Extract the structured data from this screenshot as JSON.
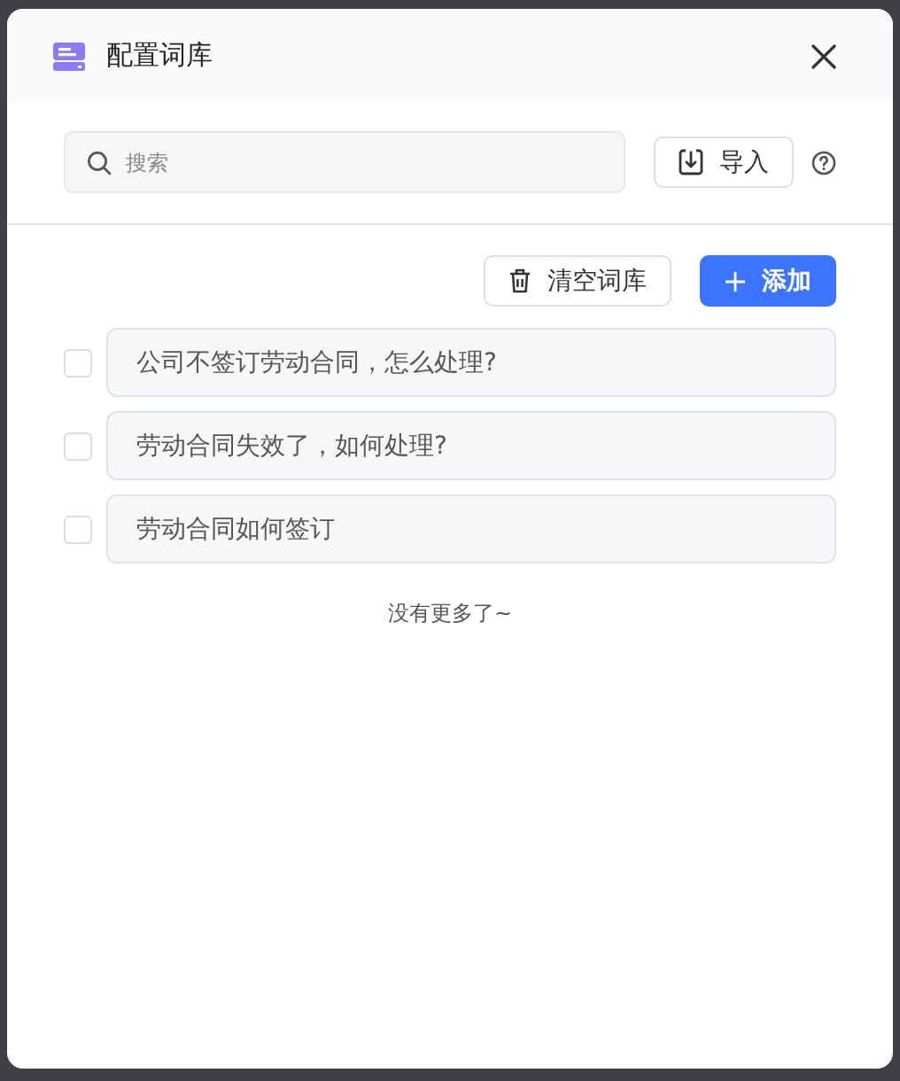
{
  "dialog": {
    "title": "配置词库"
  },
  "search": {
    "placeholder": "搜索"
  },
  "import_button": {
    "label": "导入"
  },
  "clear_button": {
    "label": "清空词库"
  },
  "add_button": {
    "label": "添加"
  },
  "entries": [
    {
      "text": "公司不签订劳动合同，怎么处理?",
      "checked": false
    },
    {
      "text": "劳动合同失效了，如何处理?",
      "checked": false
    },
    {
      "text": "劳动合同如何签订",
      "checked": false
    }
  ],
  "end_note": "没有更多了~"
}
